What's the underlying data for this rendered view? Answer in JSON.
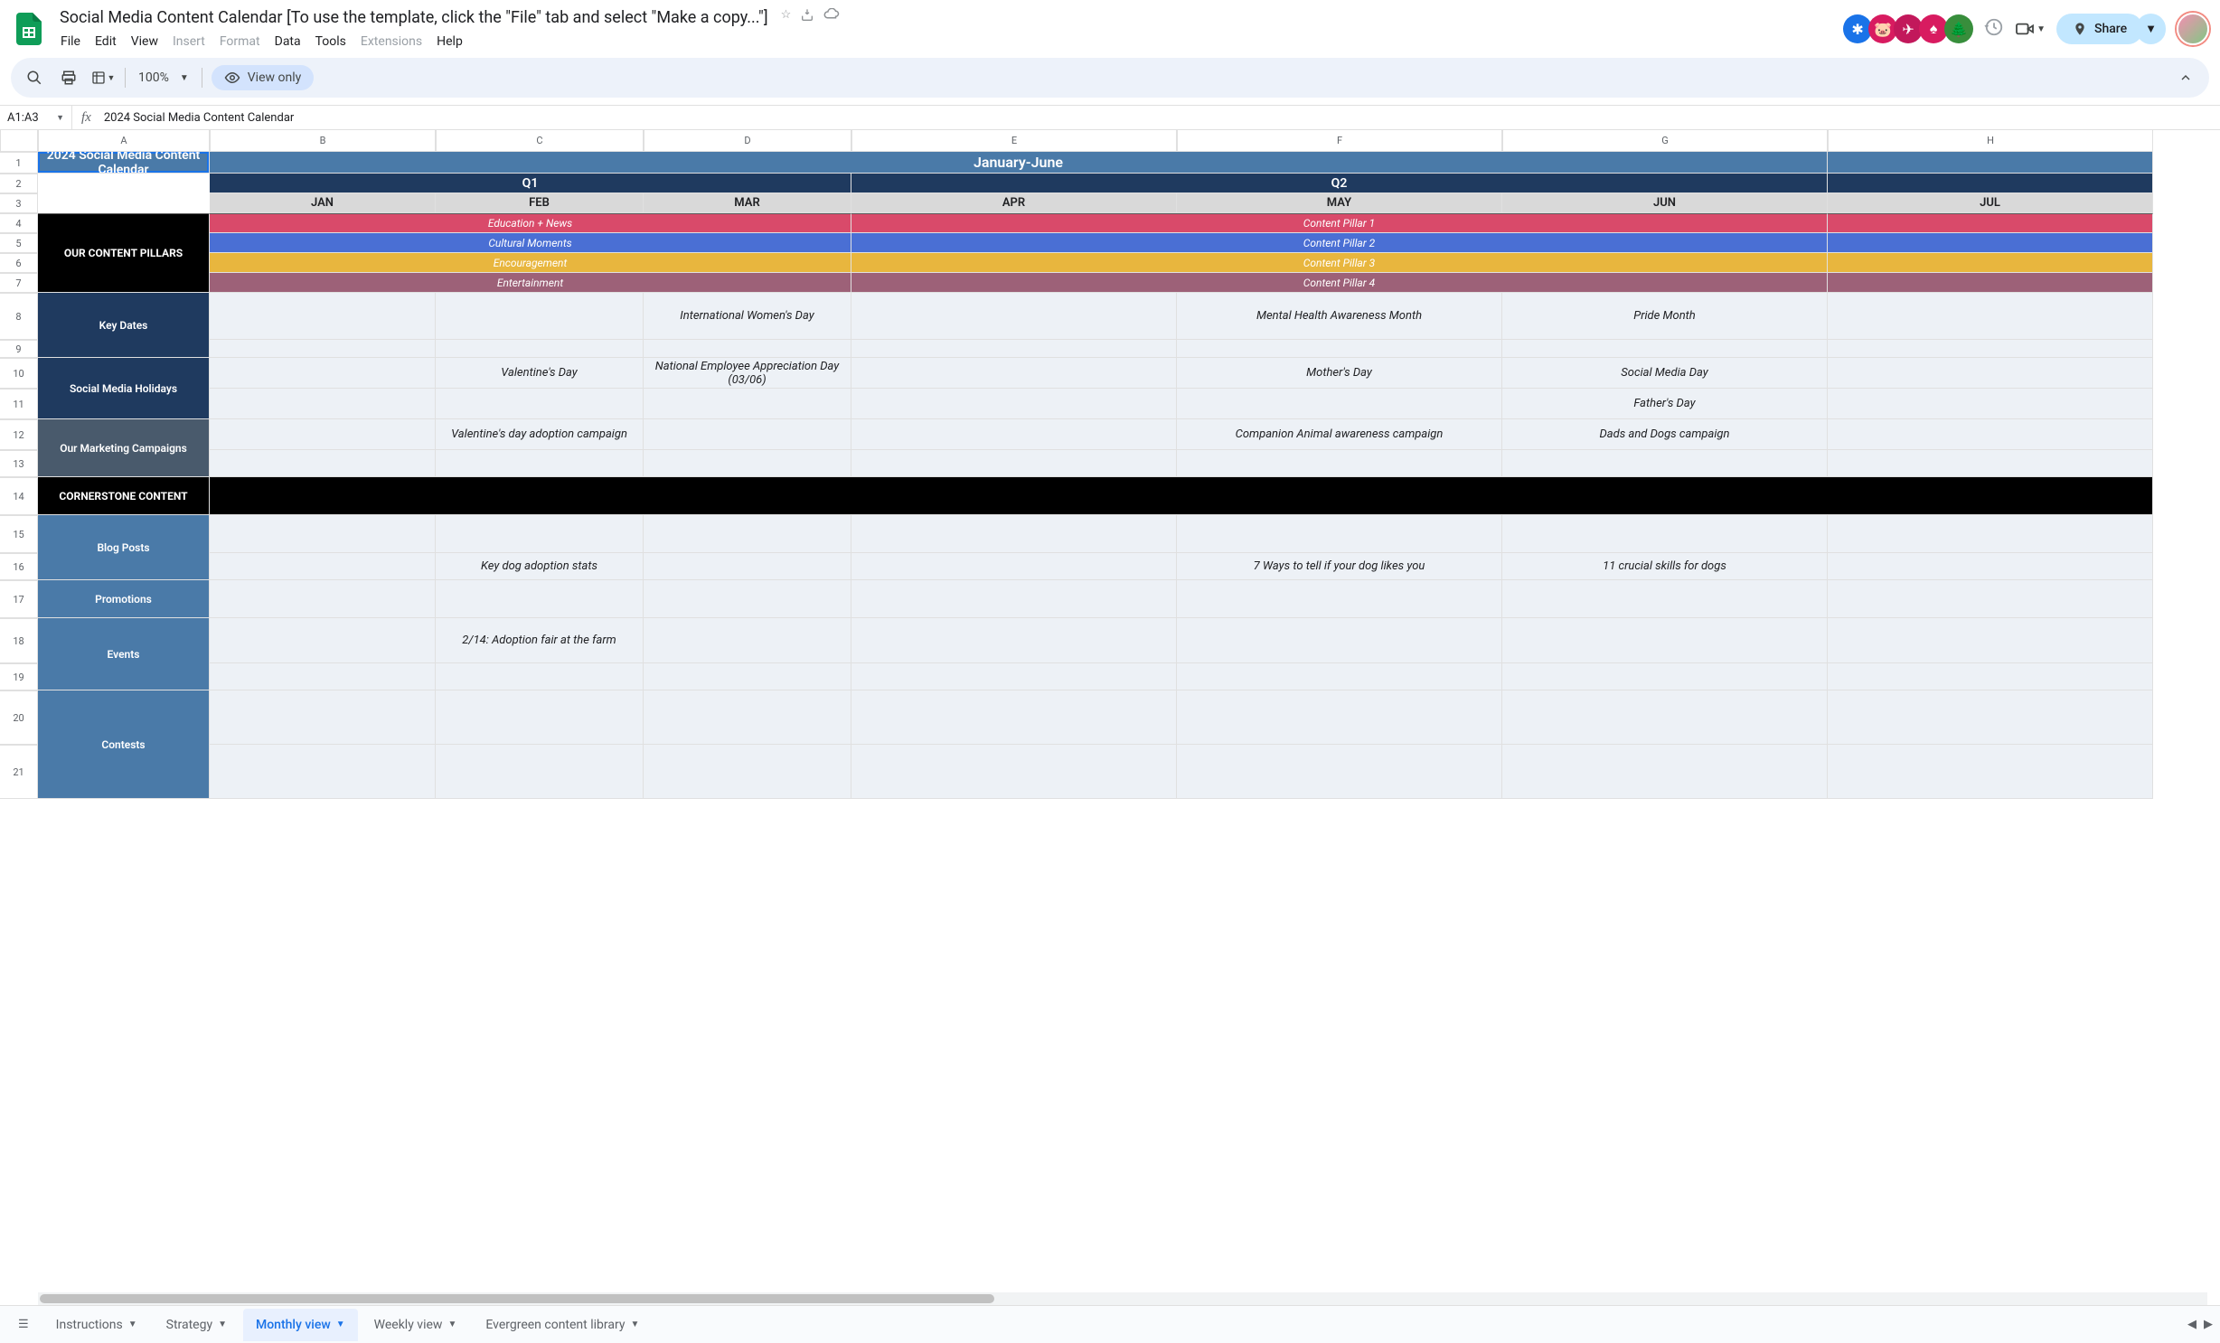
{
  "doc": {
    "title": "Social Media Content Calendar [To use the template, click the \"File\" tab and select \"Make a copy...\"]"
  },
  "menu": [
    "File",
    "Edit",
    "View",
    "Insert",
    "Format",
    "Data",
    "Tools",
    "Extensions",
    "Help"
  ],
  "menu_disabled": [
    "Insert",
    "Format",
    "Extensions"
  ],
  "toolbar": {
    "zoom": "100%",
    "view_only": "View only"
  },
  "share": {
    "label": "Share"
  },
  "formula": {
    "name_box": "A1:A3",
    "value": "2024 Social Media Content Calendar"
  },
  "columns": [
    "A",
    "B",
    "C",
    "D",
    "E",
    "F",
    "G",
    "H"
  ],
  "rows": [
    "1",
    "2",
    "3",
    "4",
    "5",
    "6",
    "7",
    "8",
    "9",
    "10",
    "11",
    "12",
    "13",
    "14",
    "15",
    "16",
    "17",
    "18",
    "19",
    "20",
    "21"
  ],
  "cells": {
    "a_title": "2024 Social Media Content Calendar",
    "period": "January-June",
    "q1": "Q1",
    "q2": "Q2",
    "months": {
      "jan": "JAN",
      "feb": "FEB",
      "mar": "MAR",
      "apr": "APR",
      "may": "MAY",
      "jun": "JUN",
      "jul": "JUL"
    },
    "labels": {
      "pillars": "OUR CONTENT PILLARS",
      "keydates": "Key Dates",
      "holidays": "Social Media Holidays",
      "campaigns": "Our Marketing Campaigns",
      "cornerstone": "CORNERSTONE CONTENT",
      "blog": "Blog Posts",
      "promo": "Promotions",
      "events": "Events",
      "contests": "Contests"
    },
    "pillars_q1": {
      "p1": "Education + News",
      "p2": "Cultural Moments",
      "p3": "Encouragement",
      "p4": "Entertainment"
    },
    "pillars_q2": {
      "p1": "Content Pillar 1",
      "p2": "Content Pillar 2",
      "p3": "Content Pillar 3",
      "p4": "Content Pillar 4"
    },
    "keydates": {
      "mar": "International Women's Day",
      "may": "Mental Health Awareness Month",
      "jun": "Pride Month"
    },
    "holidays": {
      "feb": "Valentine's Day",
      "mar": "National Employee Appreciation Day (03/06)",
      "may": "Mother's Day",
      "jun": "Social Media Day",
      "jun2": "Father's Day"
    },
    "campaigns": {
      "feb": "Valentine's day adoption campaign",
      "may": "Companion Animal awareness campaign",
      "jun": "Dads and Dogs campaign"
    },
    "blog": {
      "feb": "Key dog adoption stats",
      "may": "7 Ways to tell if your dog likes you",
      "jun": "11 crucial skills for dogs"
    },
    "events": {
      "feb": "2/14: Adoption fair at the farm"
    }
  },
  "tabs": [
    {
      "label": "Instructions",
      "active": false
    },
    {
      "label": "Strategy",
      "active": false
    },
    {
      "label": "Monthly view",
      "active": true
    },
    {
      "label": "Weekly view",
      "active": false
    },
    {
      "label": "Evergreen content library",
      "active": false
    }
  ],
  "avatar_colors": [
    "#1a73e8",
    "#d81b60",
    "#c2185b",
    "#d81b60",
    "#388e3c"
  ]
}
